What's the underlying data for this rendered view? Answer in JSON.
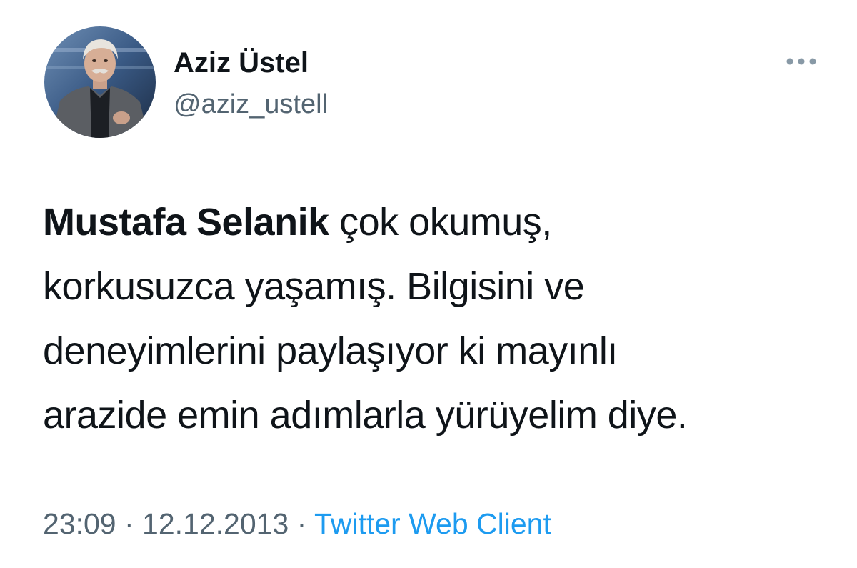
{
  "author": {
    "display_name": "Aziz Üstel",
    "handle": "@aziz_ustell"
  },
  "tweet": {
    "mention": "Mustafa Selanik",
    "line1_rest": " çok okumuş,",
    "line2": "korkusuzca yaşamış. Bilgisini ve",
    "line3": "deneyimlerini paylaşıyor ki mayınlı",
    "line4": "arazide emin adımlarla yürüyelim diye."
  },
  "meta": {
    "time": "23:09",
    "separator1": " · ",
    "date": "12.12.2013",
    "separator2": " · ",
    "source": "Twitter Web Client"
  },
  "icons": {
    "more": "more-horizontal-icon"
  },
  "colors": {
    "text": "#0f1419",
    "secondary": "#536471",
    "link": "#1d9bf0"
  }
}
